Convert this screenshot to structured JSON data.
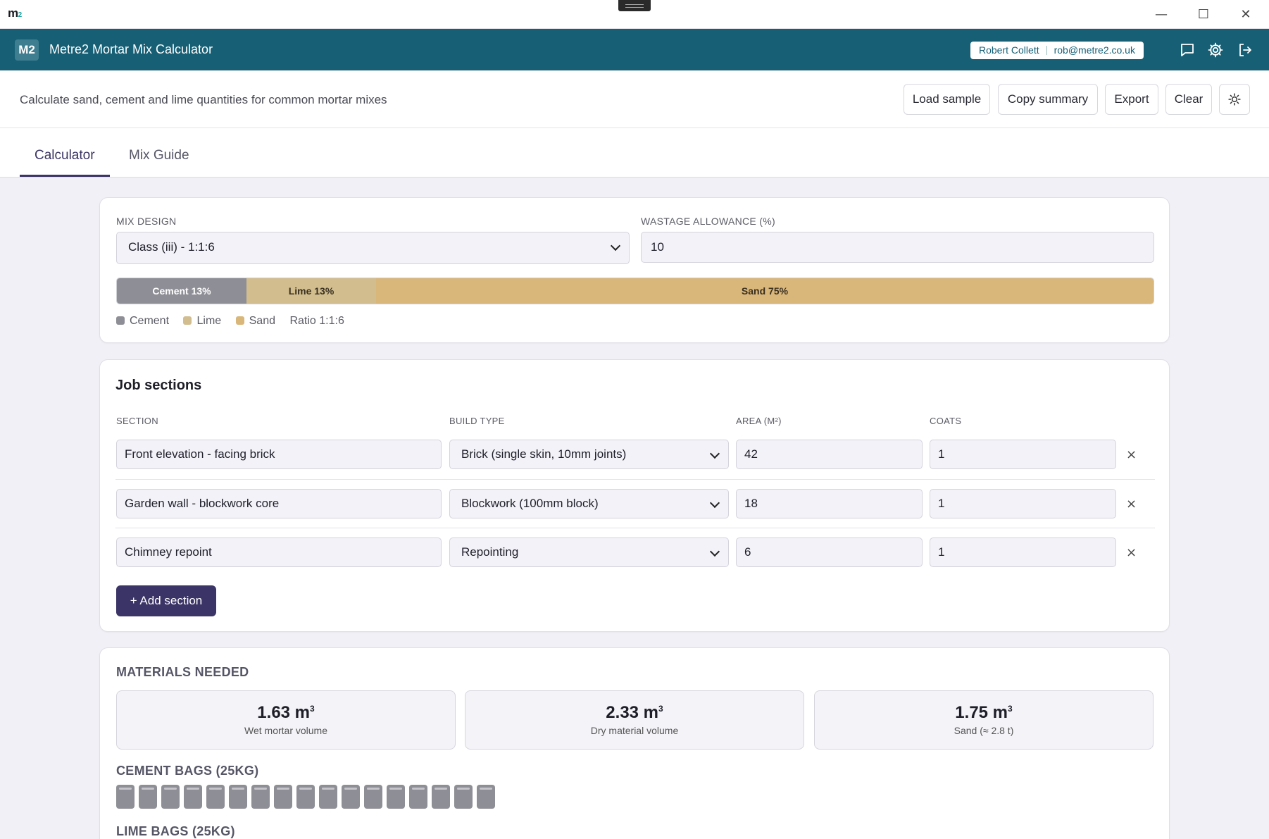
{
  "window": {
    "logo_text": "m",
    "logo_sub": "2",
    "minimize": "—",
    "maximize": "☐",
    "close": "✕"
  },
  "appbar": {
    "badge": "M2",
    "title": "Metre2 Mortar Mix Calculator",
    "user_name": "Robert Collett",
    "user_email": "rob@metre2.co.uk",
    "icons": [
      "chat-icon",
      "gear-icon",
      "logout-icon"
    ]
  },
  "toolbar": {
    "subtitle": "Calculate sand, cement and lime quantities for common mortar mixes",
    "load_sample": "Load sample",
    "copy_summary": "Copy summary",
    "export": "Export",
    "clear": "Clear",
    "theme_icon": "sun-icon"
  },
  "tabs": [
    {
      "label": "Calculator",
      "active": true
    },
    {
      "label": "Mix Guide",
      "active": false
    }
  ],
  "mix": {
    "design_label": "MIX DESIGN",
    "design_value": "Class (iii) - 1:1:6",
    "wastage_label": "WASTAGE ALLOWANCE (%)",
    "wastage_value": "10",
    "segments": [
      {
        "label": "Cement 13%",
        "percent": 12.5,
        "color": "#8e8e96",
        "text_color": "#ffffff"
      },
      {
        "label": "Lime 13%",
        "percent": 12.5,
        "color": "#d1bd8e",
        "text_color": "#3a3020"
      },
      {
        "label": "Sand 75%",
        "percent": 75,
        "color": "#d9b679",
        "text_color": "#3a3020"
      }
    ],
    "legend": [
      {
        "label": "Cement",
        "color": "#8e8e96"
      },
      {
        "label": "Lime",
        "color": "#d1bd8e"
      },
      {
        "label": "Sand",
        "color": "#d9b679"
      }
    ],
    "ratio_text": "Ratio 1:1:6"
  },
  "job": {
    "title": "Job sections",
    "headers": {
      "section": "SECTION",
      "build_type": "BUILD TYPE",
      "area": "AREA (M²)",
      "coats": "COATS"
    },
    "rows": [
      {
        "section": "Front elevation - facing brick",
        "build_type": "Brick (single skin, 10mm joints)",
        "area": "42",
        "coats": "1"
      },
      {
        "section": "Garden wall - blockwork core",
        "build_type": "Blockwork (100mm block)",
        "area": "18",
        "coats": "1"
      },
      {
        "section": "Chimney repoint",
        "build_type": "Repointing",
        "area": "6",
        "coats": "1"
      }
    ],
    "remove_glyph": "×",
    "add_label": "+ Add section"
  },
  "materials": {
    "title": "MATERIALS NEEDED",
    "unit_sup": "3",
    "boxes": [
      {
        "value": "1.63 m",
        "caption": "Wet mortar volume"
      },
      {
        "value": "2.33 m",
        "caption": "Dry material volume"
      },
      {
        "value": "1.75 m",
        "caption": "Sand (≈ 2.8 t)"
      }
    ],
    "cement_bags_title": "CEMENT BAGS (25KG)",
    "cement_bag_count": 17,
    "lime_bags_title": "LIME BAGS (25KG)"
  }
}
